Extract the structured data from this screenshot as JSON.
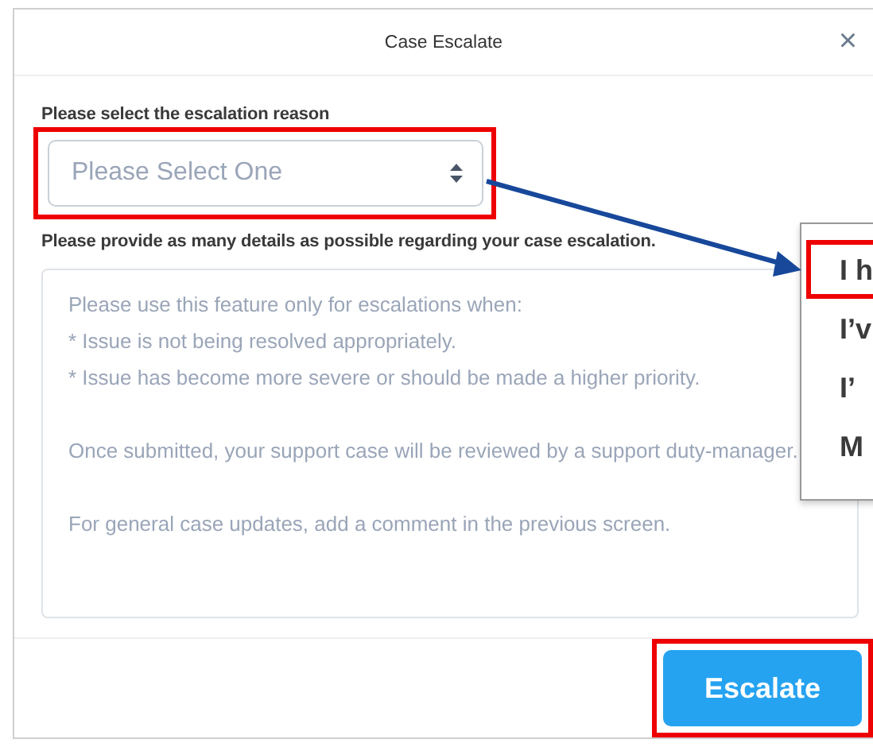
{
  "dialog": {
    "title": "Case Escalate",
    "close": "×"
  },
  "reason": {
    "label": "Please select the escalation reason",
    "placeholder": "Please Select One",
    "highlighted": true
  },
  "details": {
    "label": "Please provide as many details as possible regarding your case escalation.",
    "placeholder": "Please use this feature only for escalations when:\n* Issue is not being resolved appropriately.\n* Issue has become more severe or should be made a higher priority.\n\nOnce submitted, your support case will be reviewed by a support duty-manager.\n\nFor general case updates, add a comment in the previous screen."
  },
  "dropdown_options": [
    {
      "text": "I h",
      "highlighted": true
    },
    {
      "text": "I’v",
      "highlighted": false
    },
    {
      "text": "I’",
      "highlighted": false
    },
    {
      "text": "M",
      "highlighted": false
    }
  ],
  "buttons": [
    {
      "label": "Escalate",
      "highlighted": true
    }
  ]
}
